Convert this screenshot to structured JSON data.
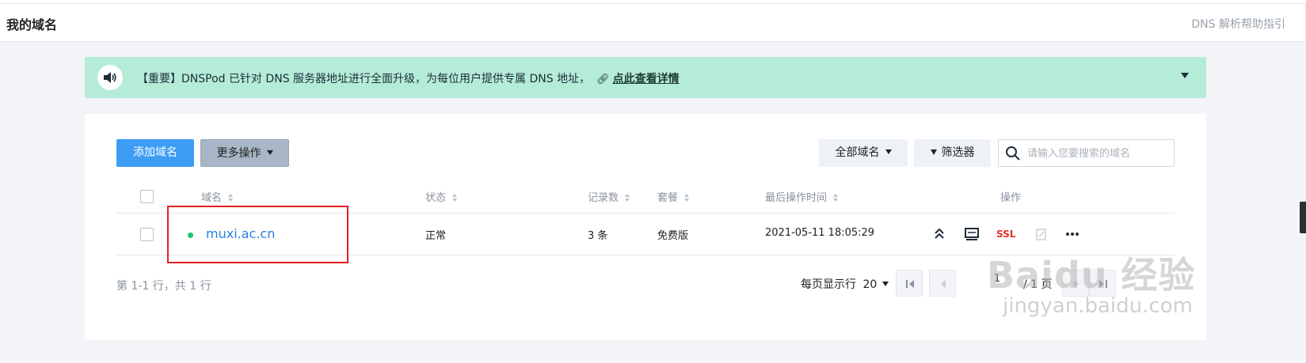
{
  "header": {
    "title": "我的域名",
    "help_link": "DNS 解析帮助指引"
  },
  "notice": {
    "text": "【重要】DNSPod 已针对 DNS 服务器地址进行全面升级，为每位用户提供专属 DNS 地址，",
    "link_label": "点此查看详情",
    "icon": "speaker-icon"
  },
  "toolbar": {
    "add_domain_label": "添加域名",
    "more_actions_label": "更多操作",
    "all_domains_label": "全部域名",
    "filter_label": "筛选器",
    "search_placeholder": "请输入您要搜索的域名"
  },
  "table": {
    "columns": {
      "domain": "域名",
      "status": "状态",
      "record_count": "记录数",
      "plan": "套餐",
      "last_modified": "最后操作时间",
      "actions": "操作"
    },
    "rows": [
      {
        "domain": "muxi.ac.cn",
        "status": "正常",
        "record_count": "3 条",
        "plan": "免费版",
        "last_modified": "2021-05-11 18:05:29",
        "status_color": "#1ec37a",
        "actions": {
          "ssl_label": "SSL"
        }
      }
    ]
  },
  "footer": {
    "count_text": "第 1-1 行，共 1 行",
    "per_page_label": "每页显示行",
    "per_page_value": "20",
    "current_page": "1",
    "total_pages_text": "/ 1 页"
  },
  "watermark": {
    "brand": "Baidu 经验",
    "url": "jingyan.baidu.com"
  },
  "colors": {
    "primary": "#3d9df5",
    "notice_bg": "#b5ecd7",
    "link": "#2a80e0",
    "ssl": "#e0302d",
    "highlight": "#e02020"
  }
}
